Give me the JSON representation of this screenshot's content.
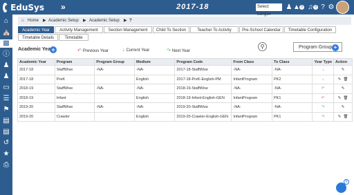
{
  "app": {
    "name": "EduSys",
    "collapse_label": "»",
    "year": "2017-18",
    "language_placeholder": "Select Langu▾",
    "notif_count": "0",
    "msg_count": "0"
  },
  "breadcrumb": {
    "home": "Home",
    "item1": "Academic Setup",
    "item2": "Academic Setup",
    "help": "?"
  },
  "tabs": [
    "Academic Year",
    "Activity Management",
    "Section Management",
    "Child To Section",
    "Teacher To Activity",
    "Pre-School Calendar",
    "Timetable Configuration",
    "Timetable Details",
    "Timetable"
  ],
  "section": {
    "title": "Academic Year",
    "prev": "Previous Year",
    "current": "Current Year",
    "next": "Next Year",
    "program_group_btn": "Program Group"
  },
  "table": {
    "headers": [
      "Academic Year",
      "Program",
      "Program Group",
      "Medium",
      "Program Code",
      "From Class",
      "To Class",
      "Year Type",
      "Action"
    ],
    "rows": [
      {
        "year": "2017-18",
        "program": "StaffWise",
        "group": "-NA-",
        "medium": "-NA-",
        "code": "2017-18-StaffWise",
        "from": "-NA-",
        "to": "-NA-",
        "type": "down"
      },
      {
        "year": "2017-18",
        "program": "PreK",
        "group": "",
        "medium": "English",
        "code": "2017-18-PreK-English-PM",
        "from": "InfantProgram",
        "to": "PK2",
        "type": "down"
      },
      {
        "year": "2018-19",
        "program": "StaffWise",
        "group": "-NA-",
        "medium": "-NA-",
        "code": "2018-19-StaffWise",
        "from": "-NA-",
        "to": "-NA-",
        "type": "back"
      },
      {
        "year": "2018-19",
        "program": "Infant",
        "group": "",
        "medium": "English",
        "code": "2018-19-Infant-English-GEN",
        "from": "InfantProgram",
        "to": "PK1",
        "type": "back"
      },
      {
        "year": "2019-20",
        "program": "StaffWise",
        "group": "-NA-",
        "medium": "-NA-",
        "code": "2019-20-StaffWise",
        "from": "-NA-",
        "to": "-NA-",
        "type": "forward"
      },
      {
        "year": "2019-20",
        "program": "Crawler",
        "group": "",
        "medium": "English",
        "code": "2019-20-Crawler-English-GEN",
        "from": "InfantProgram",
        "to": "PK1",
        "type": "forward"
      }
    ]
  },
  "chat": {
    "badge": "0"
  },
  "colors": {
    "primary": "#2d5d8f",
    "accent": "#3a7bd5"
  }
}
